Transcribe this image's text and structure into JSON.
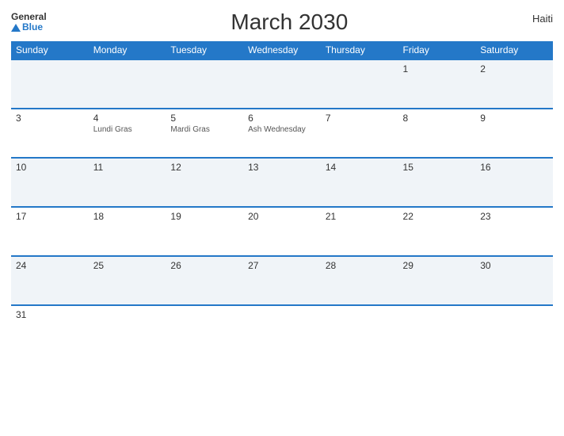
{
  "header": {
    "logo_general": "General",
    "logo_blue": "Blue",
    "title": "March 2030",
    "country": "Haiti"
  },
  "days_of_week": [
    "Sunday",
    "Monday",
    "Tuesday",
    "Wednesday",
    "Thursday",
    "Friday",
    "Saturday"
  ],
  "weeks": [
    [
      {
        "day": "",
        "events": []
      },
      {
        "day": "",
        "events": []
      },
      {
        "day": "",
        "events": []
      },
      {
        "day": "",
        "events": []
      },
      {
        "day": "",
        "events": []
      },
      {
        "day": "1",
        "events": []
      },
      {
        "day": "2",
        "events": []
      }
    ],
    [
      {
        "day": "3",
        "events": []
      },
      {
        "day": "4",
        "events": [
          "Lundi Gras"
        ]
      },
      {
        "day": "5",
        "events": [
          "Mardi Gras"
        ]
      },
      {
        "day": "6",
        "events": [
          "Ash Wednesday"
        ]
      },
      {
        "day": "7",
        "events": []
      },
      {
        "day": "8",
        "events": []
      },
      {
        "day": "9",
        "events": []
      }
    ],
    [
      {
        "day": "10",
        "events": []
      },
      {
        "day": "11",
        "events": []
      },
      {
        "day": "12",
        "events": []
      },
      {
        "day": "13",
        "events": []
      },
      {
        "day": "14",
        "events": []
      },
      {
        "day": "15",
        "events": []
      },
      {
        "day": "16",
        "events": []
      }
    ],
    [
      {
        "day": "17",
        "events": []
      },
      {
        "day": "18",
        "events": []
      },
      {
        "day": "19",
        "events": []
      },
      {
        "day": "20",
        "events": []
      },
      {
        "day": "21",
        "events": []
      },
      {
        "day": "22",
        "events": []
      },
      {
        "day": "23",
        "events": []
      }
    ],
    [
      {
        "day": "24",
        "events": []
      },
      {
        "day": "25",
        "events": []
      },
      {
        "day": "26",
        "events": []
      },
      {
        "day": "27",
        "events": []
      },
      {
        "day": "28",
        "events": []
      },
      {
        "day": "29",
        "events": []
      },
      {
        "day": "30",
        "events": []
      }
    ],
    [
      {
        "day": "31",
        "events": []
      },
      {
        "day": "",
        "events": []
      },
      {
        "day": "",
        "events": []
      },
      {
        "day": "",
        "events": []
      },
      {
        "day": "",
        "events": []
      },
      {
        "day": "",
        "events": []
      },
      {
        "day": "",
        "events": []
      }
    ]
  ]
}
